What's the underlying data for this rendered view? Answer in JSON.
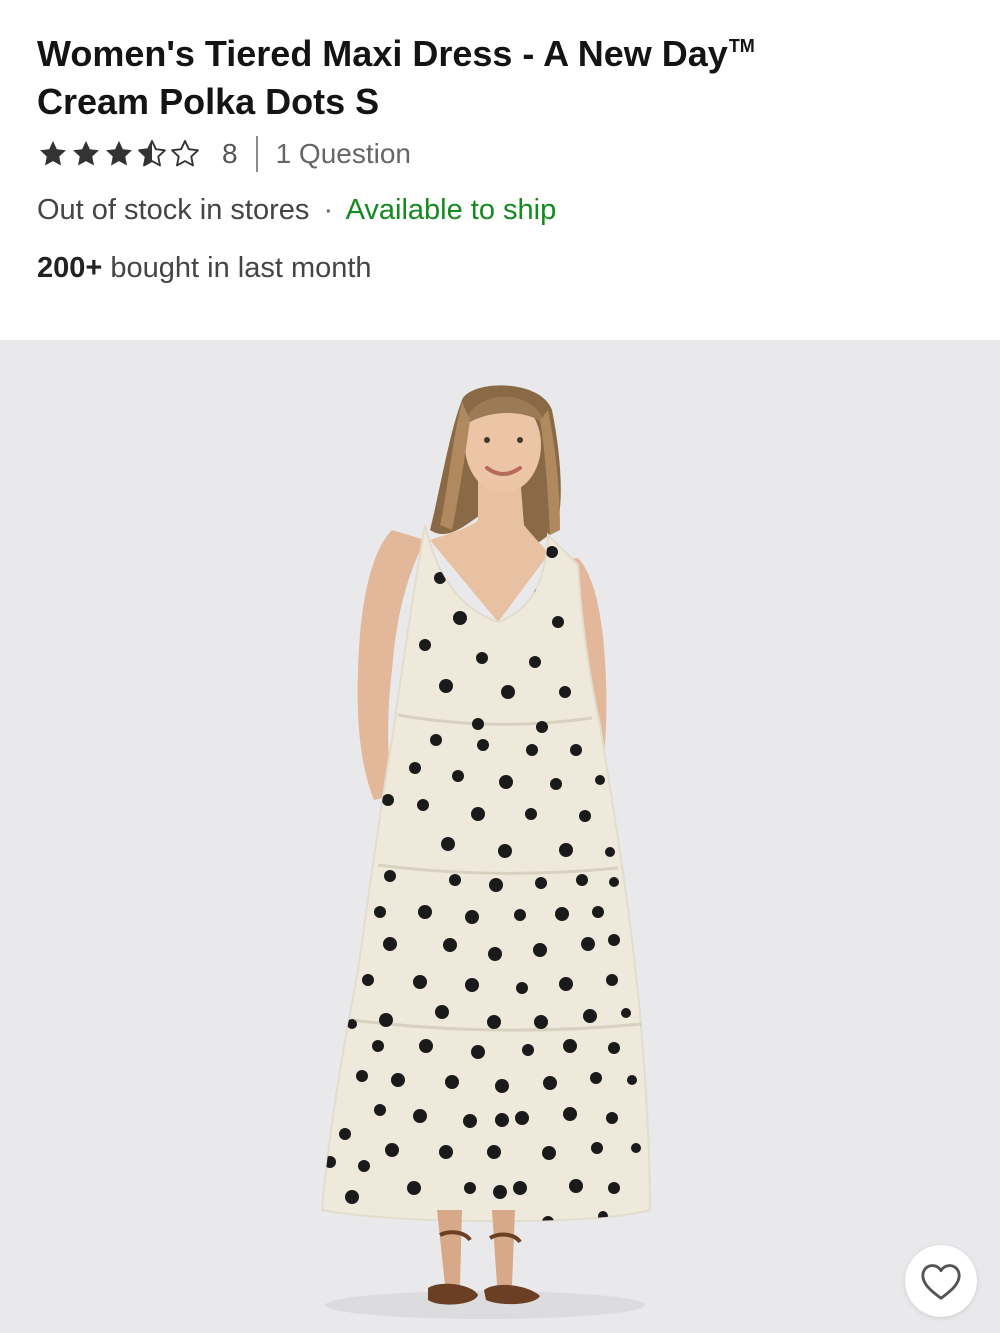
{
  "product": {
    "title": "Women's Tiered Maxi Dress - A New Day",
    "trademark": "TM",
    "subtitle": "Cream Polka Dots S"
  },
  "rating": {
    "value": 3.5,
    "max": 5,
    "count": "8",
    "questions": "1 Question"
  },
  "availability": {
    "store": "Out of stock in stores",
    "separator": "·",
    "ship": "Available to ship",
    "ship_color": "#148a1f"
  },
  "popularity": {
    "count": "200+",
    "text": "bought in last month"
  },
  "image": {
    "icon": "product-photo",
    "background": "#e9e9eb"
  },
  "favorite": {
    "icon": "heart-outline-icon"
  }
}
